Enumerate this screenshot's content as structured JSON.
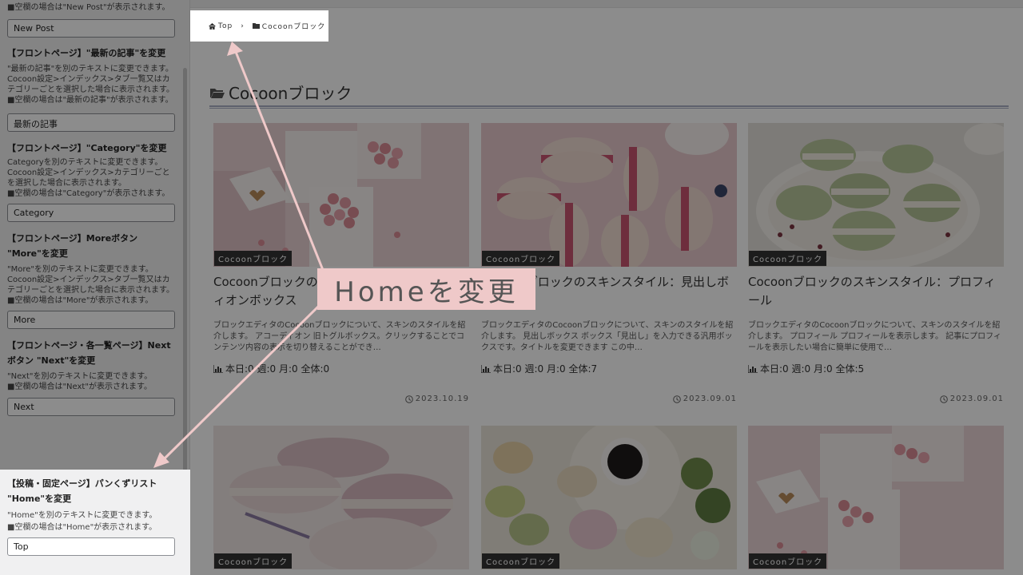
{
  "sidebar": {
    "top_desc": "■空欄の場合は\"New Post\"が表示されます。",
    "new_post_value": "New Post",
    "sections": [
      {
        "title": "【フロントページ】\"最新の記事\"を変更",
        "desc": [
          "\"最新の記事\"を別のテキストに変更できます。",
          "Cocoon設定>インデックス>タブ一覧又はカテゴリーごとを選択した場合に表示されます。",
          "■空欄の場合は\"最新の記事\"が表示されます。"
        ],
        "value": "最新の記事"
      },
      {
        "title": "【フロントページ】\"Category\"を変更",
        "desc": [
          "Categoryを別のテキストに変更できます。",
          "Cocoon設定>インデックス>カテゴリーごとを選択した場合に表示されます。",
          "■空欄の場合は\"Category\"が表示されます。"
        ],
        "value": "Category"
      },
      {
        "title": "【フロントページ】Moreボタン \"More\"を変更",
        "desc": [
          "\"More\"を別のテキストに変更できます。",
          "Cocoon設定>インデックス>タブ一覧又はカテゴリーごとを選択した場合に表示されます。",
          "■空欄の場合は\"More\"が表示されます。"
        ],
        "value": "More"
      },
      {
        "title": "【フロントページ・各一覧ページ】Nextボタン \"Next\"を変更",
        "desc": [
          "\"Next\"を別のテキストに変更できます。",
          "■空欄の場合は\"Next\"が表示されます。"
        ],
        "value": "Next"
      }
    ],
    "highlight": {
      "title": "【投稿・固定ページ】パンくずリスト \"Home\"を変更",
      "desc": [
        "\"Home\"を別のテキストに変更できます。",
        "■空欄の場合は\"Home\"が表示されます。"
      ],
      "value": "Top"
    }
  },
  "breadcrumb": {
    "home_label": "Top",
    "separator": "›",
    "category_label": "Cocoonブロック"
  },
  "category_title": "Cocoonブロック",
  "callout_text": "Homeを変更",
  "cards": [
    {
      "label": "Cocoonブロック",
      "title": "Cocoonブロックのスキンスタイル：アコーディオンボックス",
      "snippet": "ブロックエディタのCocoonブロックについて、スキンのスタイルを紹介します。 アコーディオン 旧トグルボックス。クリックすることでコンテンツ内容の表示を切り替えることができ…",
      "pv": "本日:0 週:0 月:0 全体:0",
      "date": "2023.10.19"
    },
    {
      "label": "Cocoonブロック",
      "title": "Cocoonブロックのスキンスタイル：見出しボックス",
      "snippet": "ブロックエディタのCocoonブロックについて、スキンのスタイルを紹介します。 見出しボックス ボックス「見出し」を入力できる汎用ボックスです。タイトルを変更できます この中…",
      "pv": "本日:0 週:0 月:0 全体:7",
      "date": "2023.09.01"
    },
    {
      "label": "Cocoonブロック",
      "title": "Cocoonブロックのスキンスタイル：プロフィール",
      "snippet": "ブロックエディタのCocoonブロックについて、スキンのスタイルを紹介します。 プロフィール プロフィールを表示します。 記事にプロフィールを表示したい場合に簡単に使用で…",
      "pv": "本日:0 週:0 月:0 全体:5",
      "date": "2023.09.01"
    },
    {
      "label": "Cocoonブロック"
    },
    {
      "label": "Cocoonブロック"
    },
    {
      "label": "Cocoonブロック"
    }
  ],
  "colors": {
    "callout_bg": "#efc9c9",
    "arrow": "#efc9c9",
    "sidebar_bg": "#f0f0f1"
  }
}
